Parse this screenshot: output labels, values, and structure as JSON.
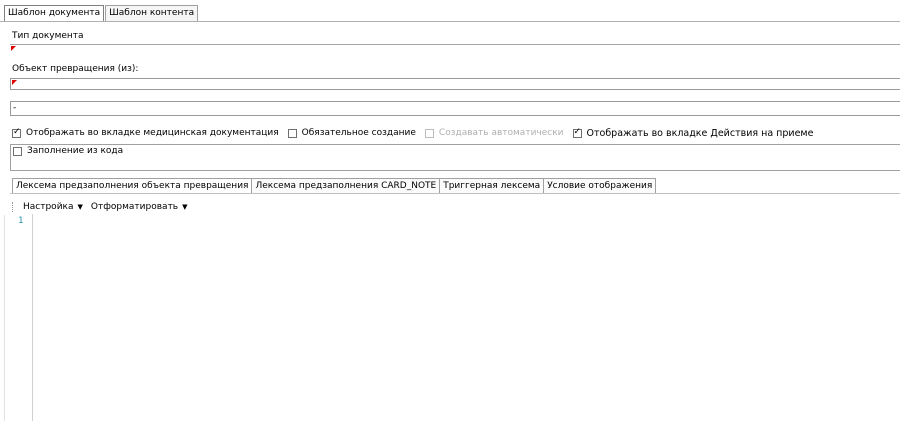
{
  "top_tabs": [
    {
      "label": "Шаблон документа",
      "active": true
    },
    {
      "label": "Шаблон контента",
      "active": false
    }
  ],
  "fields": {
    "doc_type_label": "Тип документа",
    "doc_type_value": "",
    "transform_object_label": "Объект превращения (из):",
    "transform_object_value": "",
    "third_field_value": "-"
  },
  "checkboxes": [
    {
      "label": "Отображать во вкладке медицинская документация",
      "checked": true,
      "disabled": false
    },
    {
      "label": "Обязательное создание",
      "checked": false,
      "disabled": false
    },
    {
      "label": "Создавать автоматически",
      "checked": false,
      "disabled": true
    },
    {
      "label": "Отображать во вкладке Действия на приеме",
      "checked": true,
      "disabled": false
    }
  ],
  "code_fill": {
    "label": "Заполнение из кода",
    "checked": false
  },
  "inner_tabs": [
    {
      "label": "Лексема предзаполнения объекта превращения",
      "active": true
    },
    {
      "label": "Лексема предзаполнения CARD_NOTE",
      "active": false
    },
    {
      "label": "Триггерная лексема",
      "active": false
    },
    {
      "label": "Условие отображения",
      "active": false
    }
  ],
  "toolbar": {
    "settings_label": "Настройка",
    "format_label": "Отформатировать"
  },
  "editor": {
    "line_number": "1",
    "content": ""
  },
  "colors": {
    "required_marker": "#e00000",
    "line_number": "#2b91af"
  },
  "icons": {
    "dropdown": "caret-down-icon",
    "required": "required-marker-icon"
  }
}
